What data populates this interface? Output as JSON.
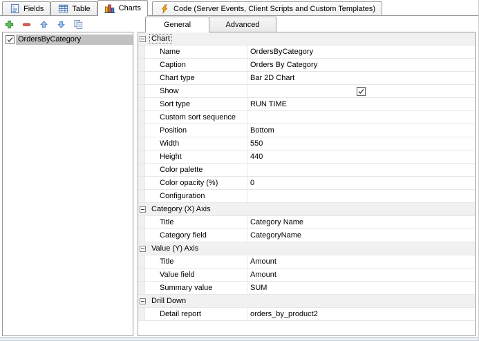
{
  "main_tabs": [
    {
      "label": "Fields",
      "icon": "fields-icon",
      "active": false
    },
    {
      "label": "Table",
      "icon": "table-icon",
      "active": false
    },
    {
      "label": "Charts",
      "icon": "charts-icon",
      "active": true
    },
    {
      "label": "Code (Server Events, Client Scripts and Custom Templates)",
      "icon": "code-icon",
      "active": false
    }
  ],
  "toolbar": [
    {
      "name": "add",
      "icon": "plus-icon"
    },
    {
      "name": "remove",
      "icon": "minus-icon"
    },
    {
      "name": "move-up",
      "icon": "arrow-up-icon"
    },
    {
      "name": "move-down",
      "icon": "arrow-down-icon"
    },
    {
      "name": "copy",
      "icon": "copy-icon"
    }
  ],
  "chart_list": [
    {
      "label": "OrdersByCategory",
      "checked": true,
      "selected": true
    }
  ],
  "panel_tabs": [
    {
      "label": "General",
      "active": true
    },
    {
      "label": "Advanced",
      "active": false
    }
  ],
  "property_groups": [
    {
      "name": "Chart",
      "focused": true,
      "rows": [
        {
          "label": "Name",
          "value": "OrdersByCategory"
        },
        {
          "label": "Caption",
          "value": "Orders By Category"
        },
        {
          "label": "Chart type",
          "value": "Bar 2D Chart"
        },
        {
          "label": "Show",
          "value": "",
          "checkbox": true,
          "checked": true
        },
        {
          "label": "Sort type",
          "value": "RUN TIME"
        },
        {
          "label": "Custom sort sequence",
          "value": ""
        },
        {
          "label": "Position",
          "value": "Bottom"
        },
        {
          "label": "Width",
          "value": "550"
        },
        {
          "label": "Height",
          "value": "440"
        },
        {
          "label": "Color palette",
          "value": ""
        },
        {
          "label": "Color opacity (%)",
          "value": "0"
        },
        {
          "label": "Configuration",
          "value": ""
        }
      ]
    },
    {
      "name": "Category (X) Axis",
      "rows": [
        {
          "label": "Title",
          "value": "Category Name"
        },
        {
          "label": "Category field",
          "value": "CategoryName"
        }
      ]
    },
    {
      "name": "Value (Y) Axis",
      "rows": [
        {
          "label": "Title",
          "value": "Amount"
        },
        {
          "label": "Value field",
          "value": "Amount"
        },
        {
          "label": "Summary value",
          "value": "SUM"
        }
      ]
    },
    {
      "name": "Drill Down",
      "rows": [
        {
          "label": "Detail report",
          "value": "orders_by_product2"
        }
      ]
    }
  ],
  "colors": {
    "border": "#9a9a9a",
    "grid_line": "#e7e7e7",
    "group_header_bg": "#f1f1f1",
    "list_selection": "#c2c2c2"
  }
}
